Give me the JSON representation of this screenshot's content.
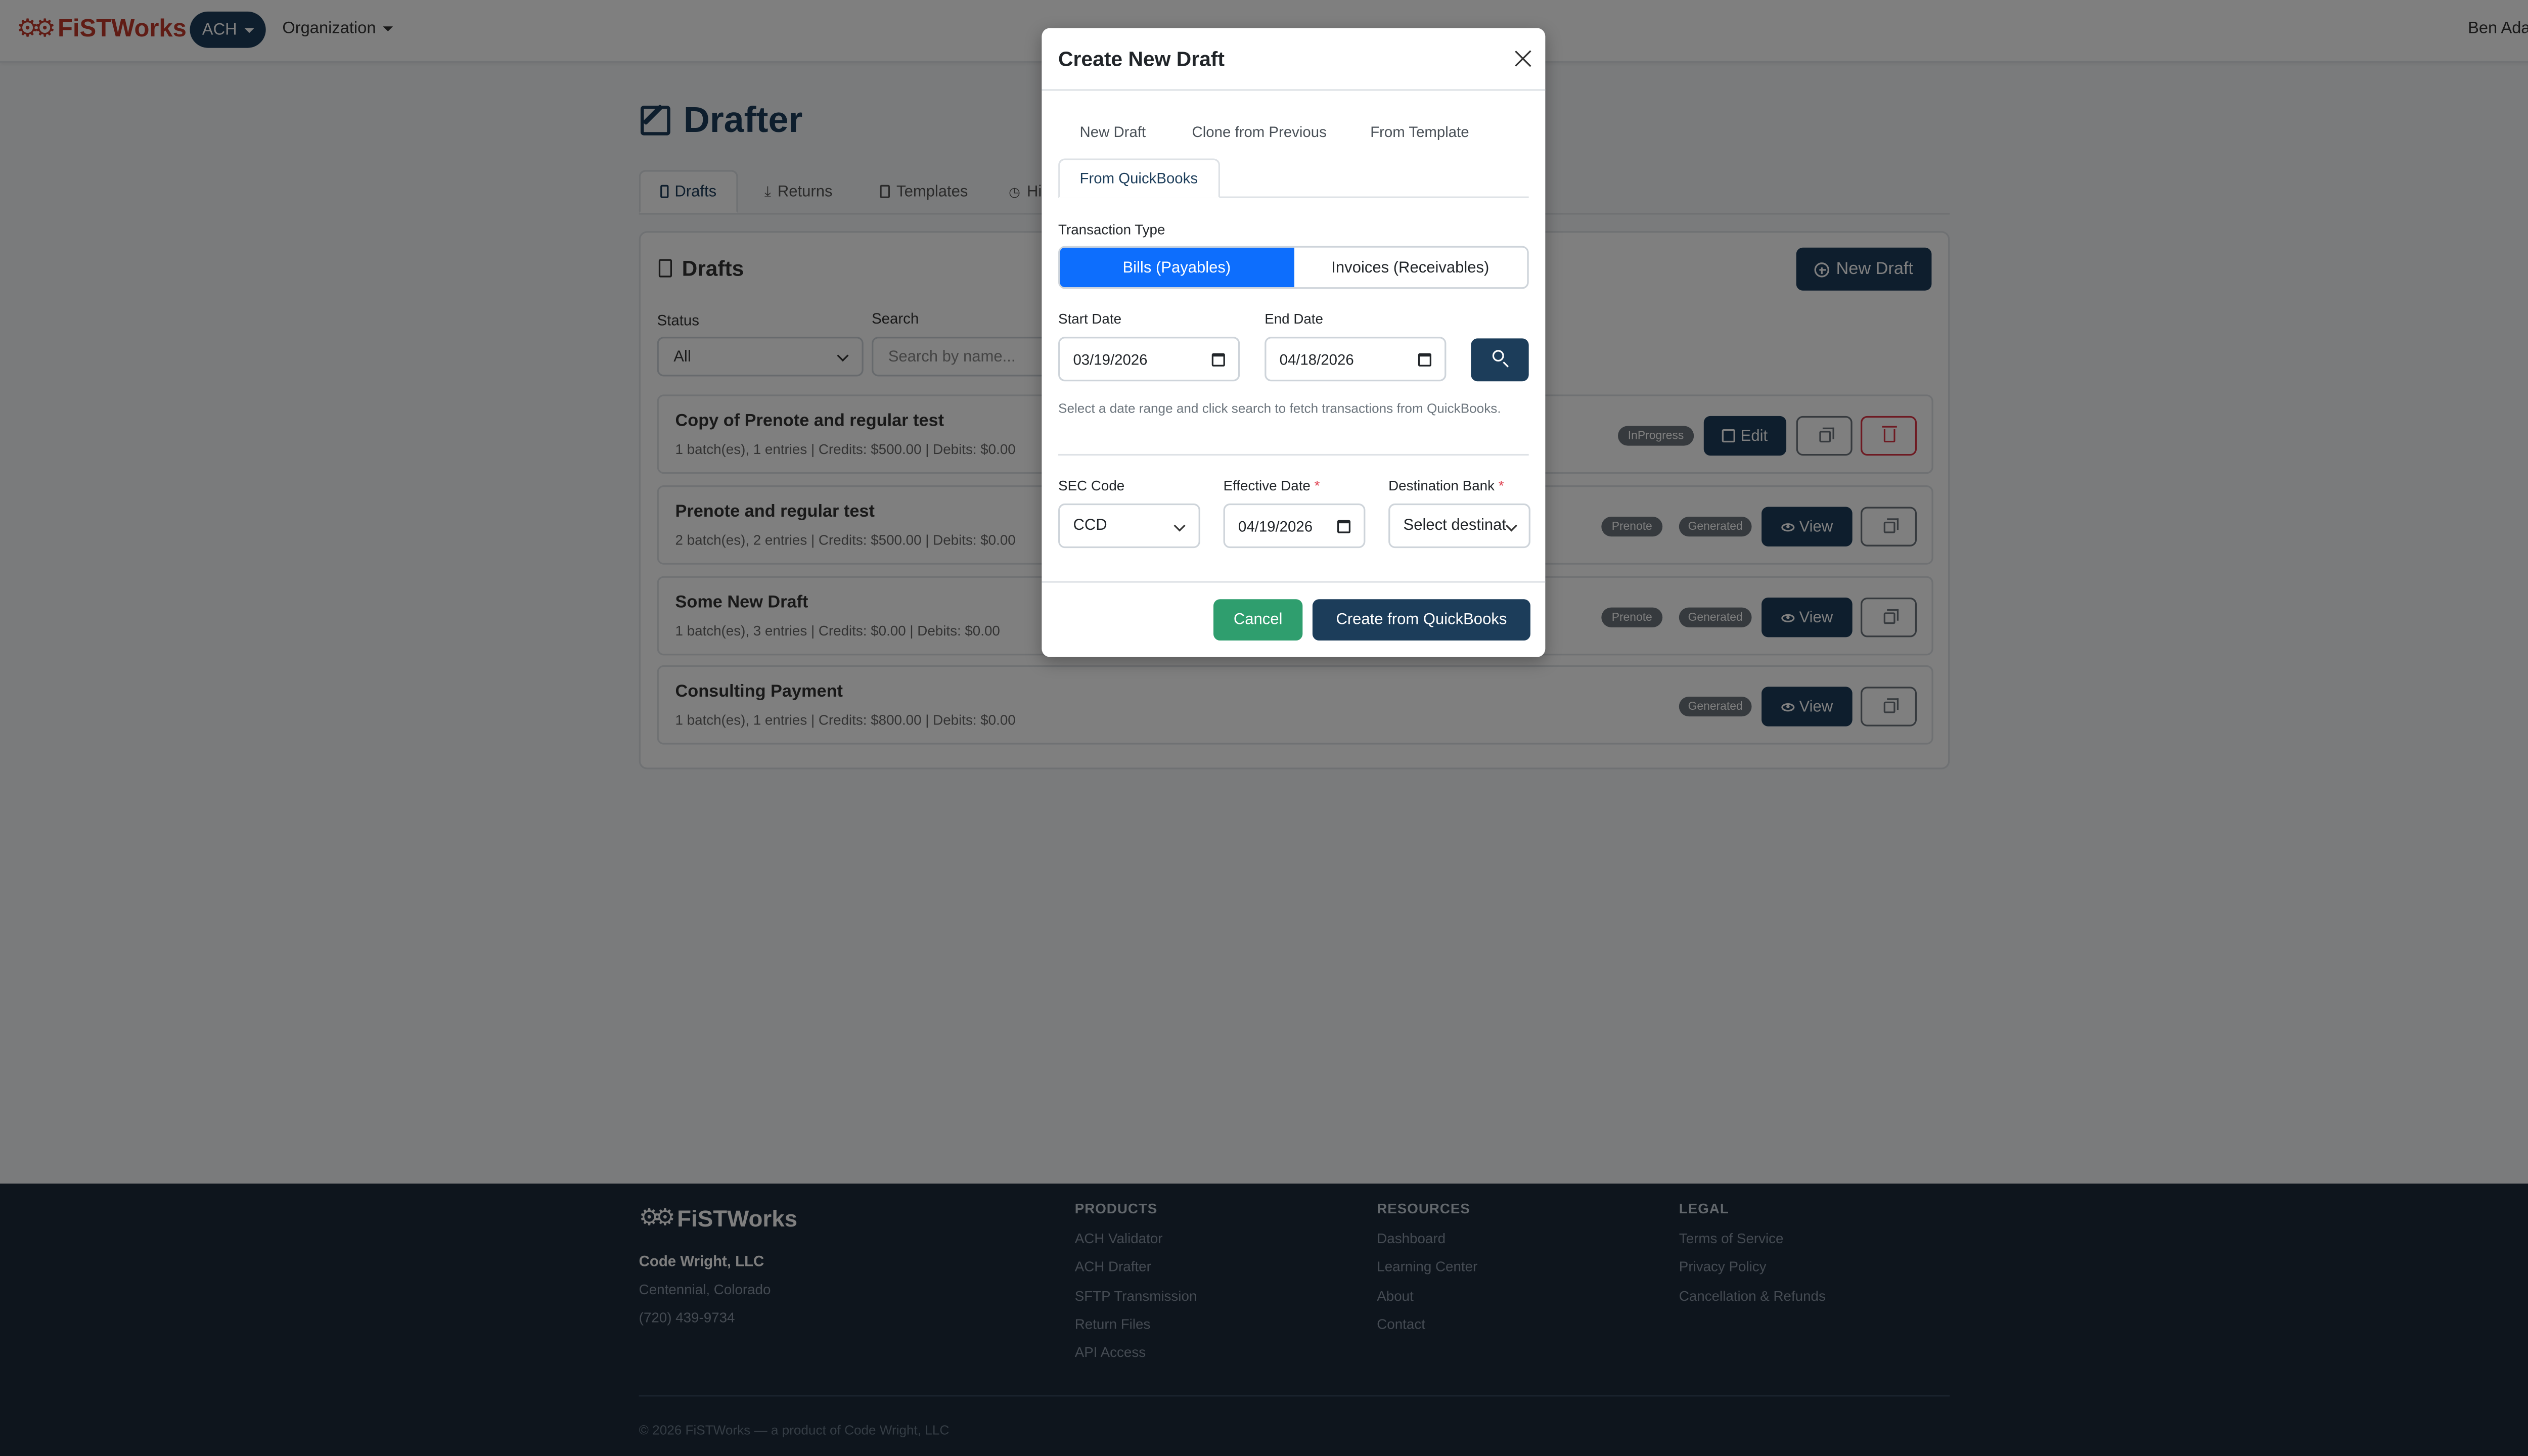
{
  "navbar": {
    "brand": "FiSTWorks",
    "ach_menu": "ACH",
    "org_menu": "Organization",
    "user_menu": "Ben Adam"
  },
  "page": {
    "title": "Drafter",
    "tabs": [
      "Drafts",
      "Returns",
      "Templates",
      "Hi"
    ]
  },
  "drafts_card": {
    "title": "Drafts",
    "new_button": "New Draft",
    "status_label": "Status",
    "status_value": "All",
    "search_label": "Search",
    "search_placeholder": "Search by name...",
    "rows": [
      {
        "name": "Copy of Prenote and regular test",
        "meta": "1 batch(es), 1 entries | Credits: $500.00 | Debits: $0.00",
        "badges": [
          "InProgress"
        ],
        "action": "Edit"
      },
      {
        "name": "Prenote and regular test",
        "meta": "2 batch(es), 2 entries | Credits: $500.00 | Debits: $0.00",
        "badges": [
          "Prenote",
          "Generated"
        ],
        "action": "View"
      },
      {
        "name": "Some New Draft",
        "meta": "1 batch(es), 3 entries | Credits: $0.00 | Debits: $0.00",
        "badges": [
          "Prenote",
          "Generated"
        ],
        "action": "View"
      },
      {
        "name": "Consulting Payment",
        "meta": "1 batch(es), 1 entries | Credits: $800.00 | Debits: $0.00",
        "badges": [
          "Generated"
        ],
        "action": "View"
      }
    ]
  },
  "modal": {
    "title": "Create New Draft",
    "tabs": [
      "New Draft",
      "Clone from Previous",
      "From Template",
      "From QuickBooks"
    ],
    "active_tab": "From QuickBooks",
    "transaction_type_label": "Transaction Type",
    "transaction_types": [
      "Bills (Payables)",
      "Invoices (Receivables)"
    ],
    "start_date_label": "Start Date",
    "start_date": "03/19/2026",
    "end_date_label": "End Date",
    "end_date": "04/18/2026",
    "help_text": "Select a date range and click search to fetch transactions from QuickBooks.",
    "sec_code_label": "SEC Code",
    "sec_code": "CCD",
    "effective_date_label": "Effective Date",
    "effective_date": "04/19/2026",
    "destination_bank_label": "Destination Bank",
    "destination_bank_placeholder": "Select destinat",
    "required_mark": "*",
    "cancel_button": "Cancel",
    "create_button": "Create from QuickBooks"
  },
  "footer": {
    "brand": "FiSTWorks",
    "company": "Code Wright, LLC",
    "location": "Centennial, Colorado",
    "phone": "(720) 439-9734",
    "products_heading": "PRODUCTS",
    "products": [
      "ACH Validator",
      "ACH Drafter",
      "SFTP Transmission",
      "Return Files",
      "API Access"
    ],
    "resources_heading": "RESOURCES",
    "resources": [
      "Dashboard",
      "Learning Center",
      "About",
      "Contact"
    ],
    "legal_heading": "LEGAL",
    "legal": [
      "Terms of Service",
      "Privacy Policy",
      "Cancellation & Refunds"
    ],
    "copyright": "© 2026 FiSTWorks — a product of Code Wright, LLC"
  },
  "colors": {
    "brand_red": "#c0392b",
    "navy": "#1c3d5a",
    "primary_blue": "#0d6efd",
    "cancel_green": "#2f9e6e",
    "footer_bg": "#1c2b3a"
  }
}
